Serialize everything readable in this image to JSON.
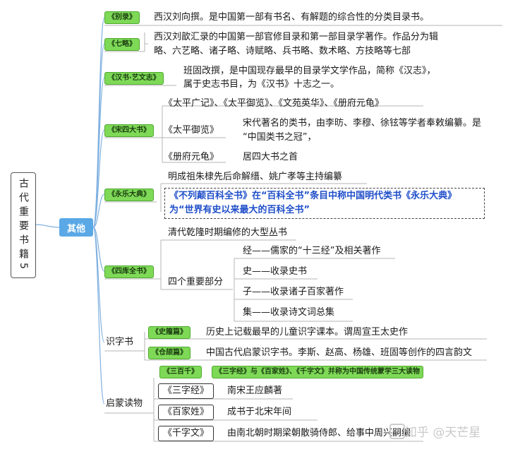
{
  "root": {
    "label": "古代重要书籍5"
  },
  "hub": {
    "label": "其他"
  },
  "bielu": {
    "tag": "《别录》",
    "desc": "西汉刘向撰。是中国第一部有书名、有解题的综合性的分类目录书。"
  },
  "qilue": {
    "tag": "《七略》",
    "desc_line1": "西汉刘歆汇录的中国第一部官修目录和第一部目录学著作。作品分为辑",
    "desc_line2": "略、六艺略、诸子略、诗赋略、兵书略、数术略、方技略等七部"
  },
  "hanshu": {
    "tag": "《汉书·艺文志》",
    "desc_line1": "班固改撰，是中国现存最早的目录学文学作品，简称《汉志》，",
    "desc_line2": "属于史志书目，为《汉书》十志之一。"
  },
  "songsi": {
    "tag": "《宋四大书》",
    "list": "《太平广记》、《太平御览》、《文苑英华》、《册府元龟》",
    "yulan_label": "《太平御览》",
    "yulan_desc1": "宋代著名的类书，由李昉、李穆、徐铉等学者奉敕编纂。是",
    "yulan_desc2": "“中国类书之冠”，",
    "cefu_label": "《册府元龟》",
    "cefu_desc": "居四大书之首"
  },
  "yongle": {
    "tag": "《永乐大典》",
    "desc": "明成祖朱棣先后命解缙、姚广孝等主持编纂",
    "highlight1": "《不列颠百科全书》在“百科全书”条目中称中国明代类书《永乐大典》",
    "highlight2": "为“世界有史以来最大的百科全书”"
  },
  "siku": {
    "tag": "《四库全书》",
    "desc": "清代乾隆时期编修的大型丛书",
    "parts_label": "四个重要部分",
    "parts": [
      "经——儒家的“十三经”及相关著作",
      "史——收录史书",
      "子——收录诸子百家著作",
      "集——收录诗文词总集"
    ]
  },
  "shizi": {
    "label": "识字书",
    "shizhou_tag": "《史籀篇》",
    "shizhou_desc": "历史上记载最早的儿童识字课本。谓周宣王太史作",
    "cangjie_tag": "《仓颉篇》",
    "cangjie_desc": "中国古代启蒙识字书。李斯、赵高、杨雄、班固等创作的四言韵文"
  },
  "qimeng": {
    "label": "启蒙读物",
    "sanbai_tag": "《三百千》",
    "sanbai_note": "《三字经》与《百家姓》、《千字文》并称为中国传统蒙学三大读物",
    "sanzi_label": "《三字经》",
    "sanzi_desc": "南宋王应麟著",
    "baijia_label": "《百家姓》",
    "baijia_desc": "成书于北宋年间",
    "qianzi_label": "《千字文》",
    "qianzi_desc": "由南北朝时期梁朝散骑侍郎、给事中周兴嗣编"
  },
  "watermark": "知乎 @天芒星"
}
